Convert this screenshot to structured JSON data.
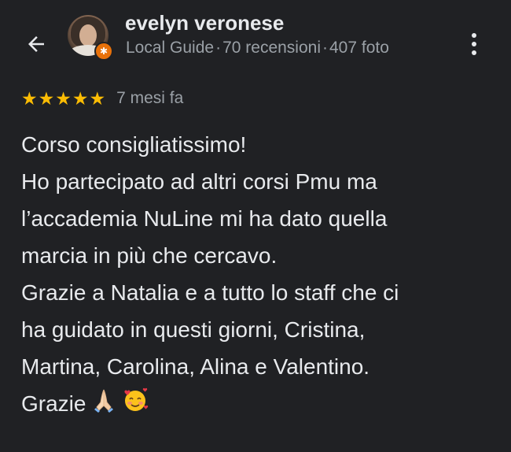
{
  "header": {
    "back_icon": "arrow-back-icon",
    "user_name": "evelyn veronese",
    "role": "Local Guide",
    "reviews_count": "70 recensioni",
    "photos_count": "407 foto",
    "separator": "·",
    "badge_icon": "local-guide-star-icon",
    "more_icon": "more-vert-icon"
  },
  "review": {
    "rating": 5,
    "rating_max": 5,
    "star_glyph": "★",
    "date": "7 mesi fa",
    "lines": [
      "Corso consigliatissimo!",
      "Ho partecipato ad altri corsi Pmu ma",
      "l’accademia NuLine mi ha dato quella",
      "marcia in più che cercavo.",
      "Grazie a Natalia e a tutto lo staff che ci",
      "ha guidato in questi giorni, Cristina,",
      "Martina, Carolina, Alina e Valentino.",
      "Grazie"
    ],
    "emojis": [
      "folded-hands-emoji",
      "smiling-face-with-hearts-emoji"
    ]
  },
  "colors": {
    "background": "#202124",
    "text_primary": "#e8eaed",
    "text_secondary": "#9aa0a6",
    "star": "#fbbc04",
    "badge": "#e8710a"
  }
}
